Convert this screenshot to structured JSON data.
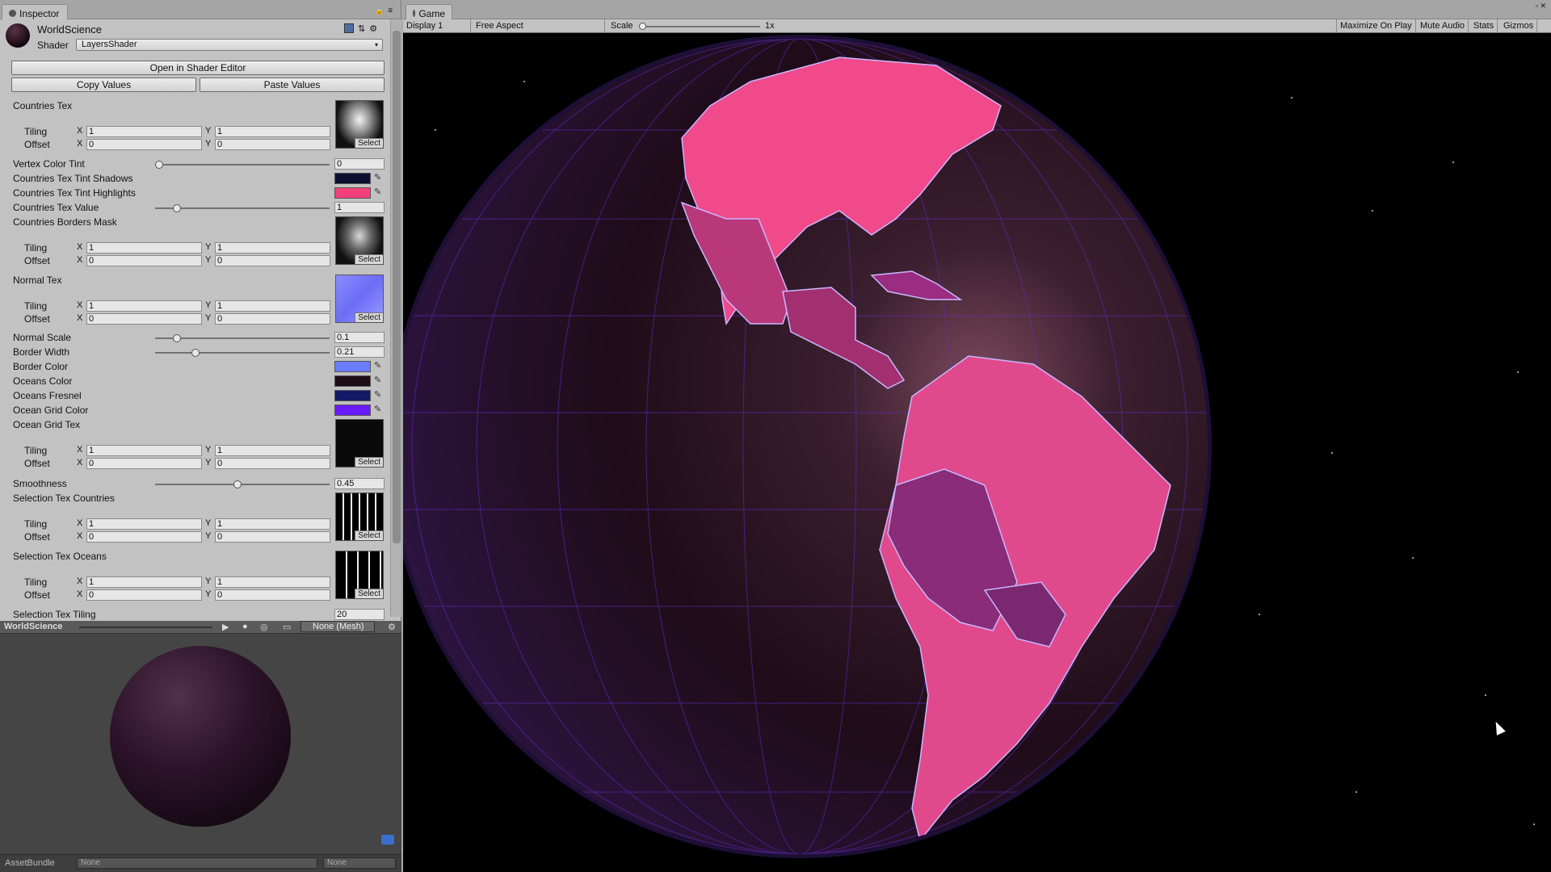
{
  "inspector": {
    "tab_label": "Inspector",
    "material_name": "WorldScience",
    "shader_label": "Shader",
    "shader_value": "LayersShader",
    "open_editor": "Open in Shader Editor",
    "copy_values": "Copy Values",
    "paste_values": "Paste Values",
    "tiling_label": "Tiling",
    "offset_label": "Offset",
    "x_label": "X",
    "y_label": "Y",
    "select_label": "Select",
    "countries_tex": {
      "label": "Countries Tex",
      "tiling_x": "1",
      "tiling_y": "1",
      "offset_x": "0",
      "offset_y": "0"
    },
    "vertex_color_tint": {
      "label": "Vertex Color Tint",
      "value": "0",
      "level": 0.0
    },
    "tint_shadows": {
      "label": "Countries Tex Tint Shadows",
      "color": "#0c1030"
    },
    "tint_highlights": {
      "label": "Countries Tex Tint Highlights",
      "color": "#f2407a"
    },
    "tex_value": {
      "label": "Countries Tex Value",
      "value": "1",
      "level": 0.1
    },
    "borders_mask": {
      "label": "Countries Borders Mask",
      "tiling_x": "1",
      "tiling_y": "1",
      "offset_x": "0",
      "offset_y": "0"
    },
    "normal_tex": {
      "label": "Normal Tex",
      "tiling_x": "1",
      "tiling_y": "1",
      "offset_x": "0",
      "offset_y": "0"
    },
    "normal_scale": {
      "label": "Normal Scale",
      "value": "0.1",
      "level": 0.1
    },
    "border_width": {
      "label": "Border Width",
      "value": "0.21",
      "level": 0.21
    },
    "border_color": {
      "label": "Border Color",
      "color": "#6a7dff"
    },
    "oceans_color": {
      "label": "Oceans Color",
      "color": "#1e0c16"
    },
    "oceans_fresnel": {
      "label": "Oceans Fresnel",
      "color": "#141a66"
    },
    "ocean_grid_color": {
      "label": "Ocean Grid Color",
      "color": "#6a1cff"
    },
    "ocean_grid_tex": {
      "label": "Ocean Grid Tex",
      "tiling_x": "1",
      "tiling_y": "1",
      "offset_x": "0",
      "offset_y": "0"
    },
    "smoothness": {
      "label": "Smoothness",
      "value": "0.45",
      "level": 0.45
    },
    "sel_tex_countries": {
      "label": "Selection Tex Countries",
      "tiling_x": "1",
      "tiling_y": "1",
      "offset_x": "0",
      "offset_y": "0"
    },
    "sel_tex_oceans": {
      "label": "Selection Tex Oceans",
      "tiling_x": "1",
      "tiling_y": "1",
      "offset_x": "0",
      "offset_y": "0"
    },
    "sel_tex_tiling": {
      "label": "Selection Tex Tiling",
      "value": "20"
    }
  },
  "preview": {
    "title": "WorldScience",
    "mesh": "None (Mesh)",
    "assetbundle_label": "AssetBundle",
    "assetbundle_value": "None",
    "variant_value": "None"
  },
  "game": {
    "tab_label": "Game",
    "display": "Display 1",
    "aspect": "Free Aspect",
    "scale_label": "Scale",
    "scale_value": "1x",
    "maximize": "Maximize On Play",
    "mute": "Mute Audio",
    "stats": "Stats",
    "gizmos": "Gizmos"
  }
}
